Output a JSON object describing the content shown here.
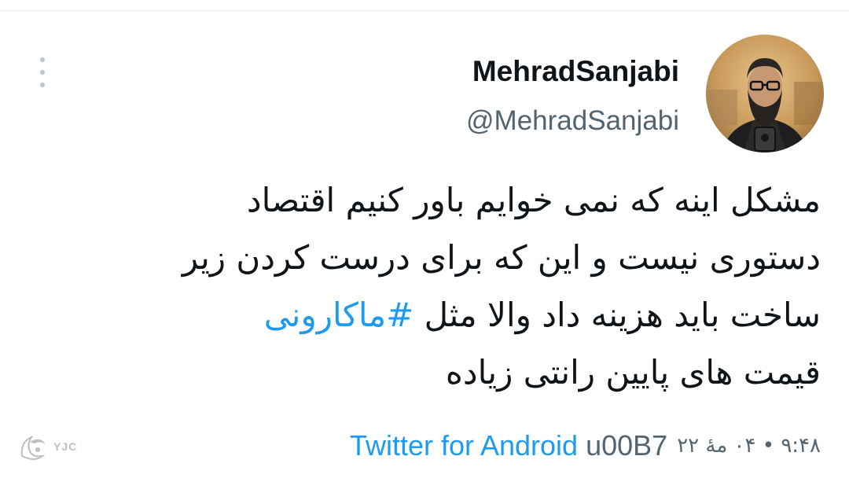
{
  "tweet": {
    "author": {
      "display_name": "MehradSanjabi",
      "handle": "@MehradSanjabi"
    },
    "text_lines": [
      "مشکل اینه که نمی خوایم باور کنیم اقتصاد",
      "دستوری نیست و این که برای درست کردن زیر",
      "ساخت باید هزینه داد والا مثل",
      "قیمت های پایین رانتی زیاده"
    ],
    "hashtag": "#ماکارونی",
    "time": "۹:۴۸ • ۰۴ مهٔ ۲۲",
    "source": "Twitter for Android",
    "source_code": "u00B7"
  },
  "watermark": {
    "text": "YJC"
  },
  "colors": {
    "link": "#1d9bf0",
    "secondary_text": "#536471",
    "primary_text": "#0f1419"
  },
  "icons": {
    "more": "more-vertical-icon"
  }
}
